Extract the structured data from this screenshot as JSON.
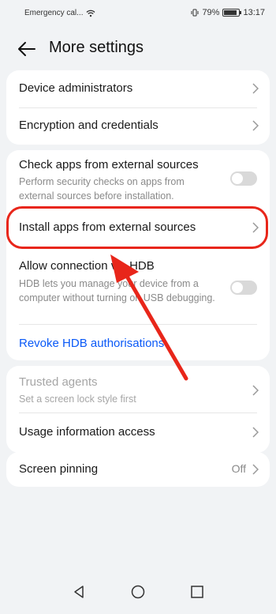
{
  "status_bar": {
    "carrier": "Emergency cal...",
    "battery": "79%",
    "time": "13:17"
  },
  "header": {
    "back_icon": "back-arrow-icon",
    "title": "More settings"
  },
  "group1": {
    "items": [
      {
        "label": "Device administrators",
        "icon": "chevron-right-icon"
      },
      {
        "label": "Encryption and credentials",
        "icon": "chevron-right-icon"
      }
    ]
  },
  "group2": {
    "check_apps": {
      "label": "Check apps from external sources",
      "description": "Perform security checks on apps from external sources before installation.",
      "toggle_on": false
    },
    "install_apps": {
      "label": "Install apps from external sources",
      "icon": "chevron-right-icon"
    },
    "allow_hdb": {
      "label": "Allow connection via HDB",
      "description": "HDB lets you manage your device from a computer without turning on USB debugging.",
      "toggle_on": false
    },
    "revoke_link": "Revoke HDB authorisations"
  },
  "group3": {
    "trusted_agents": {
      "label": "Trusted agents",
      "description": "Set a screen lock style first"
    },
    "usage_access": {
      "label": "Usage information access"
    }
  },
  "group4": {
    "screen_pinning": {
      "label": "Screen pinning",
      "value": "Off"
    }
  },
  "annotation": {
    "highlight_color": "#e8261a"
  },
  "colors": {
    "accent": "#0a59f7",
    "background": "#f1f3f5"
  },
  "nav_bar": {
    "back": "nav-back-icon",
    "home": "nav-home-icon",
    "recents": "nav-recents-icon"
  }
}
